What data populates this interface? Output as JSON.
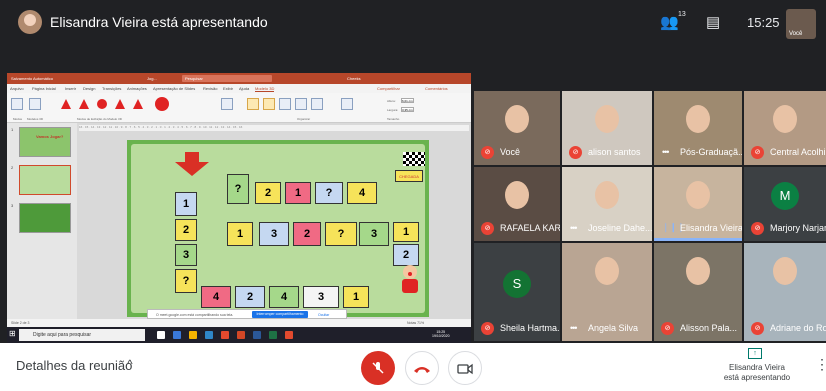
{
  "topbar": {
    "presenter_title": "Elisandra Vieira está apresentando",
    "participants_count": "13",
    "time": "15:25",
    "self_label": "Você"
  },
  "ppt": {
    "title_left": "Salvamento Automático",
    "doc_name": "Jog...",
    "search_placeholder": "Pesquisar",
    "user": "Cheeks",
    "share": "Compartilhar",
    "comments": "Comentários",
    "tabs": [
      "Arquivo",
      "Página Inicial",
      "Inserir",
      "Design",
      "Transições",
      "Animações",
      "Apresentação de Slides",
      "Revisão",
      "Exibir",
      "Ajuda",
      "Modelo 3D"
    ],
    "ribbon_groups": [
      "Modos",
      "Modelos 3D",
      "Modos de Exibição do Modelo 3D",
      "Tamanho",
      "Organizar"
    ],
    "ribbon_labels": [
      "Texto Alt",
      "Avançar",
      "Recuar",
      "Painel de Seleção",
      "Alinhar",
      "Agrupar",
      "Aplicar Panorâmica e Zoom"
    ],
    "height_label": "Altura:",
    "height_value": "6,01 cm",
    "width_label": "Largura:",
    "width_value": "3,35 cm",
    "ruler": "16 · 15 · 14 · 13 · 12 · 11 · 10 · 9 · 8 · 7 · 6 · 5 · 4 · 3 · 2 · 1 · 0 · 1 · 2 · 3 · 4 · 5 · 6 · 7 · 8 · 9 · 10 · 11 · 12 · 13 · 14 · 15 · 16",
    "thumb_titles": [
      "Vamos Jogar?",
      "",
      ""
    ],
    "slide_numbers": [
      "1",
      "2",
      "3"
    ],
    "chegada": "CHEGADA",
    "share_notice": "O meet.google.com está compartilhando sua tela.",
    "share_stop": "Interromper compartilhamento",
    "share_hide": "Ocultar",
    "status_left": "Slide 2 de 3",
    "status_right": "Notas  71%",
    "taskbar_search": "Digite aqui para pesquisar",
    "taskbar_time": "15:25",
    "taskbar_date": "19/10/2020"
  },
  "slide_tiles": [
    {
      "label": "1",
      "color": "blue"
    },
    {
      "label": "2",
      "color": "yellow"
    },
    {
      "label": "3",
      "color": "green"
    },
    {
      "label": "?",
      "color": "yellow"
    },
    {
      "label": "4",
      "color": "pink"
    },
    {
      "label": "2",
      "color": "blue"
    },
    {
      "label": "4",
      "color": "green"
    },
    {
      "label": "3",
      "color": "white"
    },
    {
      "label": "1",
      "color": "yellow"
    },
    {
      "label": "?",
      "color": "green"
    },
    {
      "label": "2",
      "color": "yellow"
    },
    {
      "label": "1",
      "color": "pink"
    },
    {
      "label": "?",
      "color": "blue"
    },
    {
      "label": "4",
      "color": "yellow"
    },
    {
      "label": "1",
      "color": "yellow"
    },
    {
      "label": "3",
      "color": "blue"
    },
    {
      "label": "2",
      "color": "pink"
    },
    {
      "label": "?",
      "color": "yellow"
    },
    {
      "label": "3",
      "color": "green"
    },
    {
      "label": "1",
      "color": "yellow"
    },
    {
      "label": "2",
      "color": "blue"
    }
  ],
  "participants": [
    {
      "name": "Você",
      "status": "muted"
    },
    {
      "name": "alison santos",
      "status": "muted"
    },
    {
      "name": "Pós-Graduaçã...",
      "status": "active"
    },
    {
      "name": "Central Acolhi",
      "status": "muted"
    },
    {
      "name": "RAFAELA KAR...",
      "status": "muted"
    },
    {
      "name": "Joseline Dahe...",
      "status": "active"
    },
    {
      "name": "Elisandra Vieira",
      "status": "speaking"
    },
    {
      "name": "Marjory Narjar",
      "status": "muted",
      "letter": "M"
    },
    {
      "name": "Sheila Hartma...",
      "status": "muted",
      "letter": "S"
    },
    {
      "name": "Angela Silva",
      "status": "active"
    },
    {
      "name": "Alisson Pala...",
      "status": "muted"
    },
    {
      "name": "Adriane do Ro",
      "status": "muted"
    }
  ],
  "bottombar": {
    "meeting_details": "Detalhes da reunião",
    "presenter_line1": "Elisandra Vieira",
    "presenter_line2": "está apresentando"
  },
  "colors": {
    "mic_off": "#ea4335",
    "accent_green": "#00796b",
    "ppt_red": "#b7472a",
    "slide_green": "#69b34e"
  }
}
